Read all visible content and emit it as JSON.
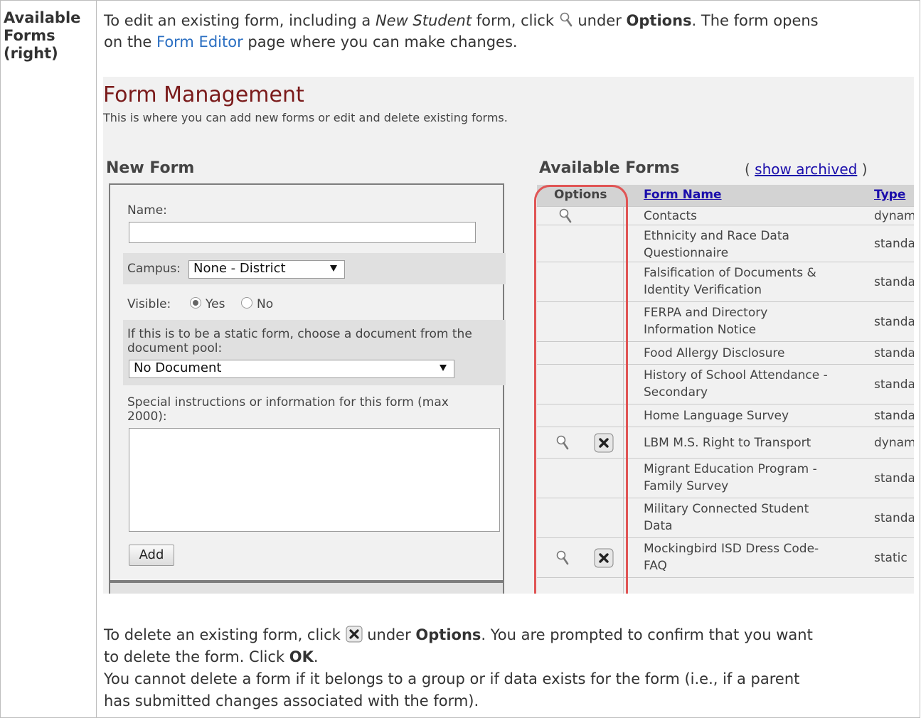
{
  "row_header": [
    "Available",
    "Forms",
    "(right)"
  ],
  "intro": {
    "p1_a": "To edit an existing form, including a ",
    "p1_b": "New Student",
    "p1_c": " form, click ",
    "p1_d": " under ",
    "p1_e": "Options",
    "p1_f": ". The form opens",
    "p2_a": "on the ",
    "p2_link": "Form Editor",
    "p2_b": " page where you can make changes."
  },
  "screenshot": {
    "title": "Form Management",
    "subtitle": "This is where you can add new forms or edit and delete existing forms.",
    "new_form": {
      "heading": "New Form",
      "name_label": "Name:",
      "campus_label": "Campus:",
      "campus_value": "None - District",
      "visible_label": "Visible:",
      "yes_label": "Yes",
      "no_label": "No",
      "static_label_1": "If this is to be a static form, choose a document from the",
      "static_label_2": "document pool:",
      "document_value": "No Document",
      "special_label_1": "Special instructions or information for this form (max",
      "special_label_2": "2000):",
      "add_button": "Add"
    },
    "available": {
      "heading": "Available Forms",
      "show_archived_open": "(",
      "show_archived": "show archived",
      "show_archived_close": ")",
      "col_options": "Options",
      "col_name": "Form Name",
      "col_type": "Type",
      "rows": [
        {
          "name1": "Contacts",
          "name2": "",
          "type": "dynamic",
          "edit": true,
          "delete": false
        },
        {
          "name1": "Ethnicity and Race Data",
          "name2": "Questionnaire",
          "type": "standard",
          "edit": false,
          "delete": false
        },
        {
          "name1": "Falsification of Documents &",
          "name2": "Identity Verification",
          "type": "standard",
          "edit": false,
          "delete": false
        },
        {
          "name1": "FERPA and Directory",
          "name2": "Information Notice",
          "type": "standard",
          "edit": false,
          "delete": false
        },
        {
          "name1": "Food Allergy Disclosure",
          "name2": "",
          "type": "standard",
          "edit": false,
          "delete": false
        },
        {
          "name1": "History of School Attendance -",
          "name2": "Secondary",
          "type": "standard",
          "edit": false,
          "delete": false
        },
        {
          "name1": "Home Language Survey",
          "name2": "",
          "type": "standard",
          "edit": false,
          "delete": false
        },
        {
          "name1": "LBM M.S. Right to Transport",
          "name2": "",
          "type": "dynamic",
          "edit": true,
          "delete": true
        },
        {
          "name1": "Migrant Education Program -",
          "name2": "Family Survey",
          "type": "standard",
          "edit": false,
          "delete": false
        },
        {
          "name1": "Military Connected Student",
          "name2": "Data",
          "type": "standard",
          "edit": false,
          "delete": false
        },
        {
          "name1": "Mockingbird ISD Dress Code-",
          "name2": "FAQ",
          "type": "static",
          "edit": true,
          "delete": true
        }
      ]
    }
  },
  "after": {
    "p3_a": "To delete an existing form, click ",
    "p3_b": " under ",
    "p3_c": "Options",
    "p3_d": ". You are prompted to confirm that you want",
    "p4_a": "to delete the form. Click ",
    "p4_b": "OK",
    "p4_c": ".",
    "p5": "You cannot delete a form if it belongs to a group or if data exists for the form (i.e., if a parent",
    "p6": "has submitted changes associated with the form)."
  }
}
